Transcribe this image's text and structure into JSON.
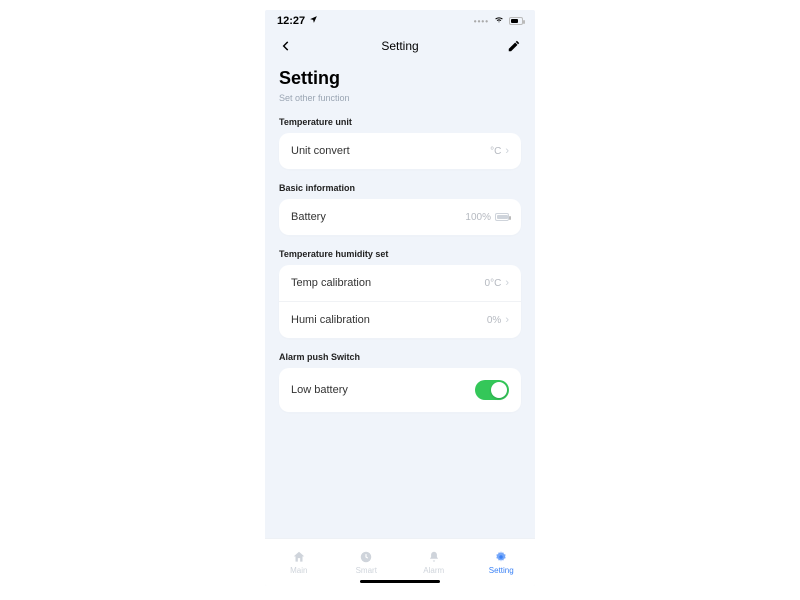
{
  "statusbar": {
    "time": "12:27"
  },
  "navbar": {
    "title": "Setting"
  },
  "header": {
    "title": "Setting",
    "subtitle": "Set other function"
  },
  "sections": {
    "tempUnit": {
      "label": "Temperature unit",
      "row": {
        "label": "Unit convert",
        "value": "°C"
      }
    },
    "basic": {
      "label": "Basic information",
      "row": {
        "label": "Battery",
        "value": "100%"
      }
    },
    "tempHumSet": {
      "label": "Temperature humidity set",
      "row1": {
        "label": "Temp calibration",
        "value": "0°C"
      },
      "row2": {
        "label": "Humi calibration",
        "value": "0%"
      }
    },
    "alarm": {
      "label": "Alarm push Switch",
      "row": {
        "label": "Low battery",
        "value": true
      }
    }
  },
  "tabs": {
    "t1": "Main",
    "t2": "Smart",
    "t3": "Alarm",
    "t4": "Setting"
  }
}
